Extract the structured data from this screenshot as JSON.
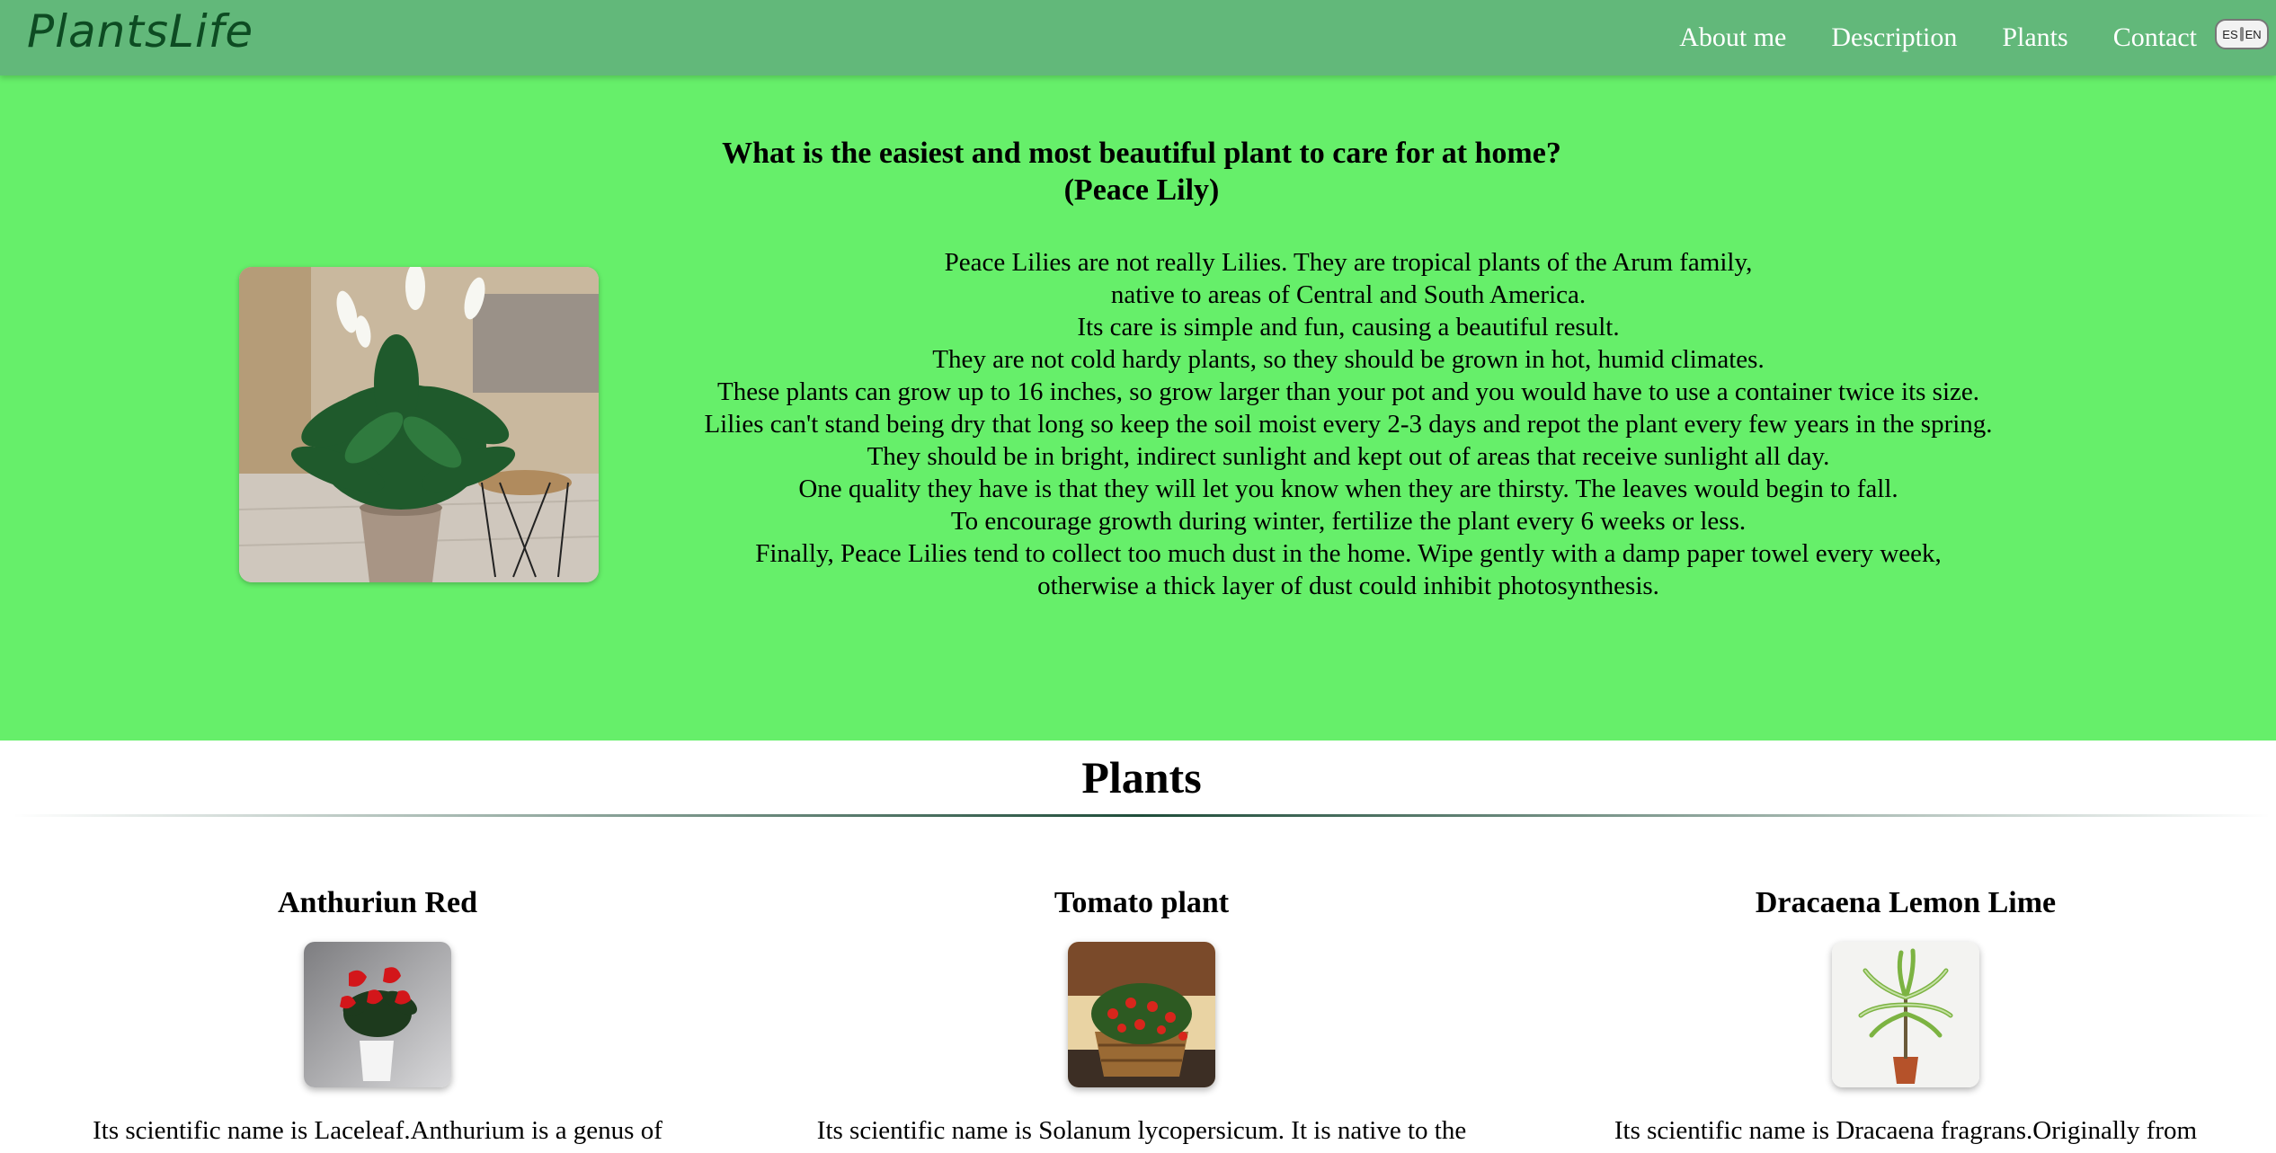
{
  "nav": {
    "logo": "PlantsLife",
    "links": [
      "About me",
      "Description",
      "Plants",
      "Contact"
    ],
    "lang": {
      "es": "ES",
      "en": "EN"
    }
  },
  "hero": {
    "title_line1": "What is the easiest and most beautiful plant to care for at home?",
    "title_line2": "(Peace Lily)",
    "paragraph": [
      "Peace Lilies are not really Lilies. They are tropical plants of the Arum family,",
      "native to areas of Central and South America.",
      "Its care is simple and fun, causing a beautiful result.",
      "They are not cold hardy plants, so they should be grown in hot, humid climates.",
      "These plants can grow up to 16 inches, so grow larger than your pot and you would have to use a container twice its size.",
      "Lilies can't stand being dry that long so keep the soil moist every 2-3 days and repot the plant every few years in the spring.",
      "They should be in bright, indirect sunlight and kept out of areas that receive sunlight all day.",
      "One quality they have is that they will let you know when they are thirsty. The leaves would begin to fall.",
      "To encourage growth during winter, fertilize the plant every 6 weeks or less.",
      "Finally, Peace Lilies tend to collect too much dust in the home. Wipe gently with a damp paper towel every week,",
      "otherwise a thick layer of dust could inhibit photosynthesis."
    ]
  },
  "plants": {
    "heading": "Plants",
    "cards": [
      {
        "title": "Anthuriun Red",
        "desc": "Its scientific name is Laceleaf.Anthurium is a genus of"
      },
      {
        "title": "Tomato plant",
        "desc": "Its scientific name is Solanum lycopersicum. It is native to the"
      },
      {
        "title": "Dracaena Lemon Lime",
        "desc": "Its scientific name is Dracaena fragrans.Originally from"
      }
    ]
  },
  "colors": {
    "navbar": "#62b87a",
    "hero_bg": "#66ef6a",
    "logo": "#0d4b22"
  }
}
